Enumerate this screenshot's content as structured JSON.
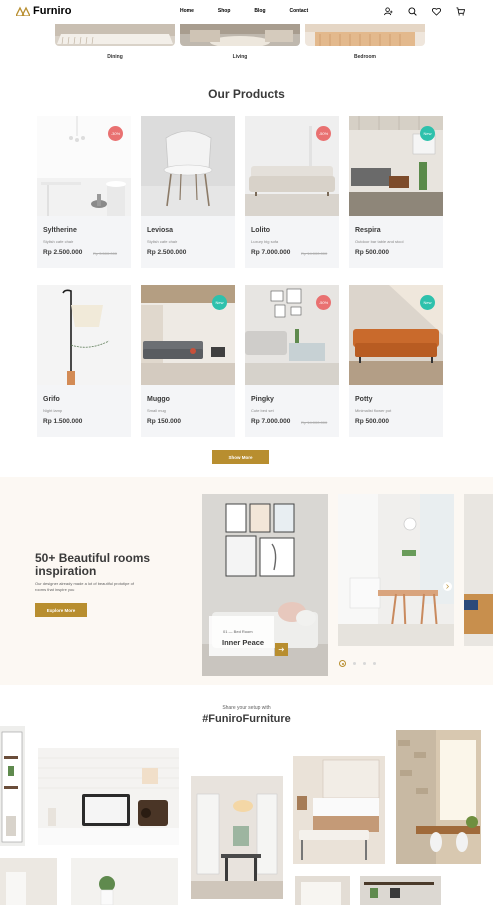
{
  "brand": {
    "name": "Furniro",
    "accent": "#b88e2f"
  },
  "nav": {
    "items": [
      "Home",
      "Shop",
      "Blog",
      "Contact"
    ]
  },
  "header_icons": [
    "user-icon",
    "search-icon",
    "heart-icon",
    "cart-icon"
  ],
  "range": {
    "items": [
      "Dining",
      "Living",
      "Bedroom"
    ]
  },
  "products": {
    "title": "Our Products",
    "items": [
      {
        "name": "Syltherine",
        "desc": "Stylish cafe chair",
        "price": "Rp 2.500.000",
        "old_price": "Rp 3.500.000",
        "badge": "-30%",
        "badge_type": "sale"
      },
      {
        "name": "Leviosa",
        "desc": "Stylish cafe chair",
        "price": "Rp 2.500.000",
        "old_price": "",
        "badge": "",
        "badge_type": ""
      },
      {
        "name": "Lolito",
        "desc": "Luxury big sofa",
        "price": "Rp 7.000.000",
        "old_price": "Rp 14.000.000",
        "badge": "-50%",
        "badge_type": "sale"
      },
      {
        "name": "Respira",
        "desc": "Outdoor bar table and stool",
        "price": "Rp 500.000",
        "old_price": "",
        "badge": "New",
        "badge_type": "new"
      },
      {
        "name": "Grifo",
        "desc": "Night lamp",
        "price": "Rp 1.500.000",
        "old_price": "",
        "badge": "",
        "badge_type": ""
      },
      {
        "name": "Muggo",
        "desc": "Small mug",
        "price": "Rp 150.000",
        "old_price": "",
        "badge": "New",
        "badge_type": "new"
      },
      {
        "name": "Pingky",
        "desc": "Cute bed set",
        "price": "Rp 7.000.000",
        "old_price": "Rp 14.000.000",
        "badge": "-50%",
        "badge_type": "sale"
      },
      {
        "name": "Potty",
        "desc": "Minimalist flower pot",
        "price": "Rp 500.000",
        "old_price": "",
        "badge": "New",
        "badge_type": "new"
      }
    ],
    "show_more": "Show More"
  },
  "inspiration": {
    "title": "50+ Beautiful rooms inspiration",
    "text": "Our designer already made a lot of beautiful prototipe of rooms that inspire you",
    "button": "Explore More",
    "slide_meta": "01 — Bed Room",
    "slide_title": "Inner Peace",
    "slide_count": 4,
    "active_slide": 1
  },
  "setup": {
    "caption": "Share your setup with",
    "hashtag": "#FuniroFurniture"
  }
}
